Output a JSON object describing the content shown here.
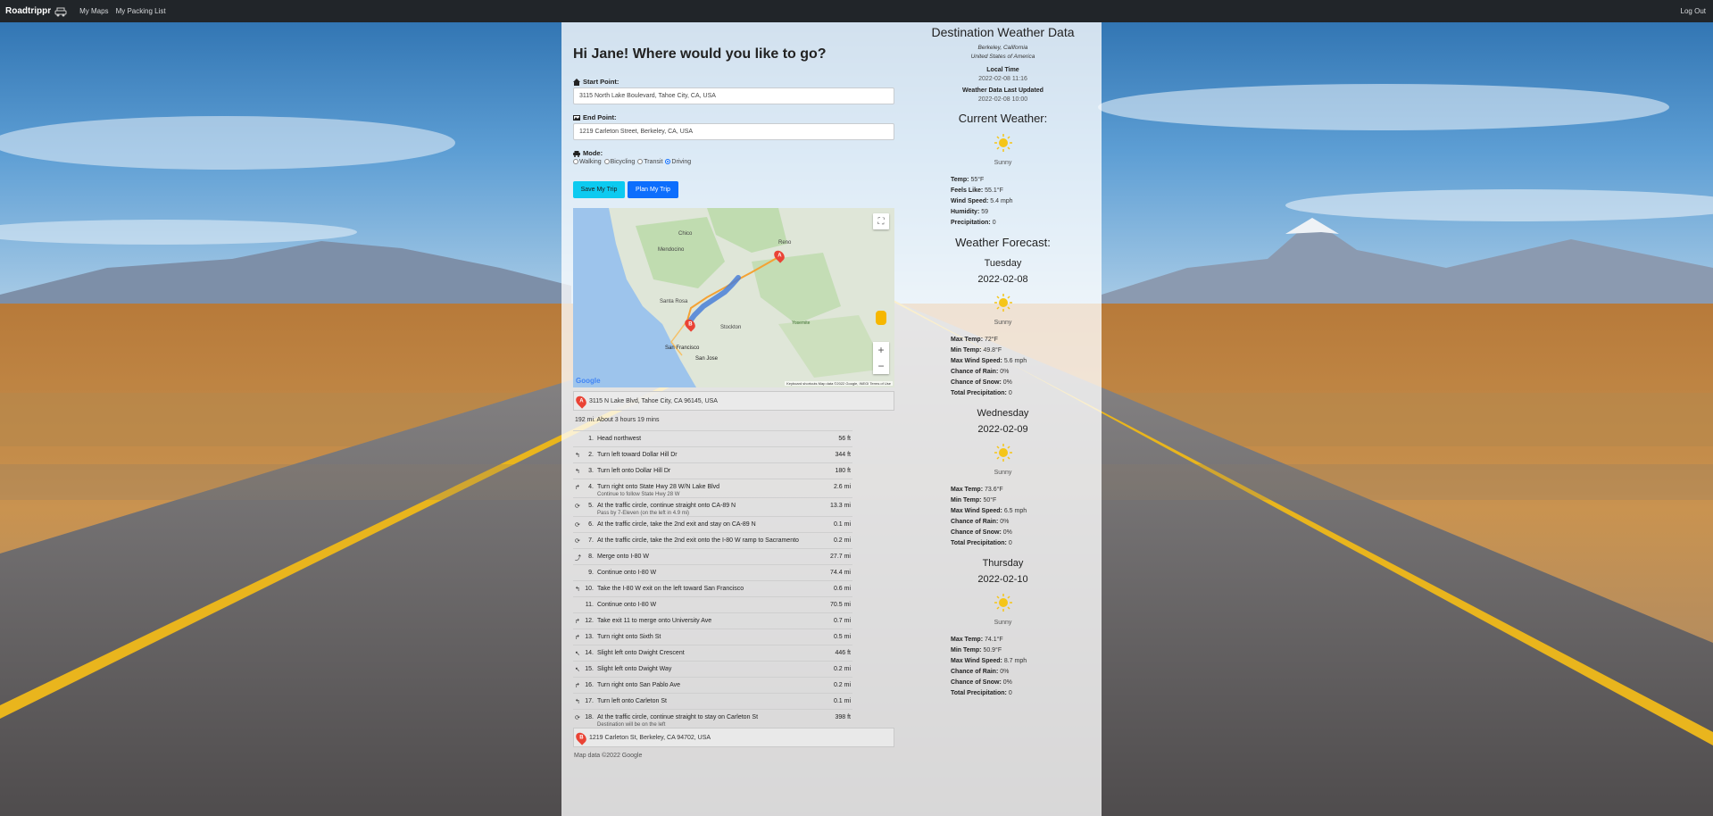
{
  "navbar": {
    "brand": "Roadtrippr",
    "links": [
      "My Maps",
      "My Packing List"
    ],
    "logout": "Log Out"
  },
  "planner": {
    "greeting": "Hi Jane! Where would you like to go?",
    "start_label": "Start Point:",
    "start_value": "3115 North Lake Boulevard, Tahoe City, CA, USA",
    "end_label": "End Point:",
    "end_value": "1219 Carleton Street, Berkeley, CA, USA",
    "mode_label": "Mode:",
    "modes": [
      "Walking",
      "Bicycling",
      "Transit",
      "Driving"
    ],
    "selected_mode": "Driving",
    "save_button": "Save My Trip",
    "plan_button": "Plan My Trip"
  },
  "map": {
    "logo": "Google",
    "attribution": "Keyboard shortcuts   Map data ©2022 Google, INEGI   Terms of Use",
    "place_labels": [
      "Plumas National Forest",
      "Mendocino National Forest",
      "Reno",
      "Carson City",
      "Eldorado National Forest",
      "Santa Rosa",
      "Oakland",
      "San Francisco",
      "San Jose",
      "Stockton",
      "Yosemite National Park",
      "Chico",
      "Sacramento"
    ]
  },
  "directions": {
    "start_address": "3115 N Lake Blvd, Tahoe City, CA 96145, USA",
    "summary": "192 mi. About 3 hours 19 mins",
    "steps": [
      {
        "n": "1.",
        "icon": "",
        "text": "Head northwest",
        "sub": "",
        "dist": "56 ft"
      },
      {
        "n": "2.",
        "icon": "↰",
        "text": "Turn left toward Dollar Hill Dr",
        "sub": "",
        "dist": "344 ft"
      },
      {
        "n": "3.",
        "icon": "↰",
        "text": "Turn left onto Dollar Hill Dr",
        "sub": "",
        "dist": "180 ft"
      },
      {
        "n": "4.",
        "icon": "↱",
        "text": "Turn right onto State Hwy 28 W/N Lake Blvd",
        "sub": "Continue to follow State Hwy 28 W",
        "dist": "2.6 mi"
      },
      {
        "n": "5.",
        "icon": "⟳",
        "text": "At the traffic circle, continue straight onto CA-89 N",
        "sub": "Pass by 7-Eleven (on the left in 4.9 mi)",
        "dist": "13.3 mi"
      },
      {
        "n": "6.",
        "icon": "⟳",
        "text": "At the traffic circle, take the 2nd exit and stay on CA-89 N",
        "sub": "",
        "dist": "0.1 mi"
      },
      {
        "n": "7.",
        "icon": "⟳",
        "text": "At the traffic circle, take the 2nd exit onto the I-80 W ramp to Sacramento",
        "sub": "",
        "dist": "0.2 mi"
      },
      {
        "n": "8.",
        "icon": "⤴",
        "text": "Merge onto I-80 W",
        "sub": "",
        "dist": "27.7 mi"
      },
      {
        "n": "9.",
        "icon": "",
        "text": "Continue onto I-80 W",
        "sub": "",
        "dist": "74.4 mi"
      },
      {
        "n": "10.",
        "icon": "↰",
        "text": "Take the I-80 W exit on the left toward San Francisco",
        "sub": "",
        "dist": "0.6 mi"
      },
      {
        "n": "11.",
        "icon": "",
        "text": "Continue onto I-80 W",
        "sub": "",
        "dist": "70.5 mi"
      },
      {
        "n": "12.",
        "icon": "↱",
        "text": "Take exit 11 to merge onto University Ave",
        "sub": "",
        "dist": "0.7 mi"
      },
      {
        "n": "13.",
        "icon": "↱",
        "text": "Turn right onto Sixth St",
        "sub": "",
        "dist": "0.5 mi"
      },
      {
        "n": "14.",
        "icon": "↖",
        "text": "Slight left onto Dwight Crescent",
        "sub": "",
        "dist": "446 ft"
      },
      {
        "n": "15.",
        "icon": "↖",
        "text": "Slight left onto Dwight Way",
        "sub": "",
        "dist": "0.2 mi"
      },
      {
        "n": "16.",
        "icon": "↱",
        "text": "Turn right onto San Pablo Ave",
        "sub": "",
        "dist": "0.2 mi"
      },
      {
        "n": "17.",
        "icon": "↰",
        "text": "Turn left onto Carleton St",
        "sub": "",
        "dist": "0.1 mi"
      },
      {
        "n": "18.",
        "icon": "⟳",
        "text": "At the traffic circle, continue straight to stay on Carleton St",
        "sub": "Destination will be on the left",
        "dist": "398 ft"
      }
    ],
    "end_address": "1219 Carleton St, Berkeley, CA 94702, USA",
    "map_data": "Map data ©2022 Google"
  },
  "weather": {
    "title": "Destination Weather Data",
    "city": "Berkeley, California",
    "country": "United States of America",
    "local_time_label": "Local Time",
    "local_time": "2022-02-08 11:16",
    "updated_label": "Weather Data Last Updated",
    "updated": "2022-02-08 10:00",
    "current_heading": "Current Weather:",
    "current": {
      "condition": "Sunny",
      "temp_label": "Temp:",
      "temp": "55°F",
      "feels_label": "Feels Like:",
      "feels": "55.1°F",
      "wind_label": "Wind Speed:",
      "wind": "5.4 mph",
      "humidity_label": "Humidity:",
      "humidity": "59",
      "precip_label": "Precipitation:",
      "precip": "0"
    },
    "forecast_heading": "Weather Forecast:",
    "forecast": [
      {
        "day": "Tuesday",
        "date": "2022-02-08",
        "condition": "Sunny",
        "max": "72°F",
        "min": "49.8°F",
        "wind": "5.6 mph",
        "rain": "0%",
        "snow": "0%",
        "precip": "0"
      },
      {
        "day": "Wednesday",
        "date": "2022-02-09",
        "condition": "Sunny",
        "max": "73.6°F",
        "min": "50°F",
        "wind": "6.5 mph",
        "rain": "0%",
        "snow": "0%",
        "precip": "0"
      },
      {
        "day": "Thursday",
        "date": "2022-02-10",
        "condition": "Sunny",
        "max": "74.1°F",
        "min": "50.9°F",
        "wind": "8.7 mph",
        "rain": "0%",
        "snow": "0%",
        "precip": "0"
      }
    ],
    "labels": {
      "max": "Max Temp:",
      "min": "Min Temp:",
      "wind": "Max Wind Speed:",
      "rain": "Chance of Rain:",
      "snow": "Chance of Snow:",
      "precip": "Total Precipitation:"
    }
  }
}
